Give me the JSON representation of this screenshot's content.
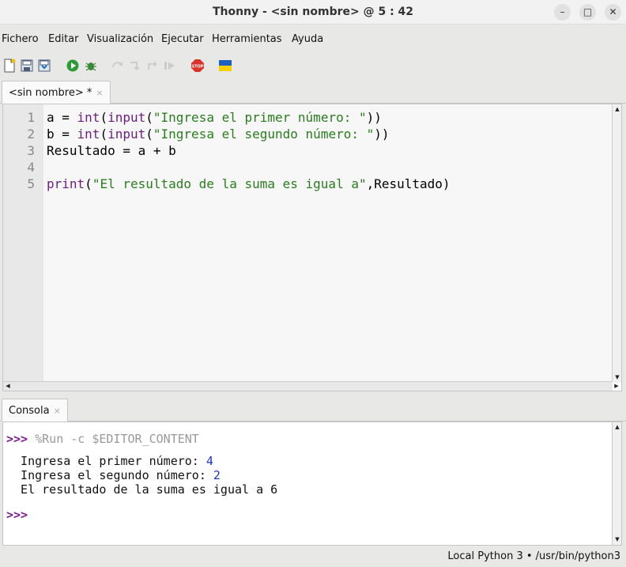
{
  "window": {
    "title": "Thonny  -  <sin nombre>  @  5 : 42"
  },
  "menu": [
    "Fichero",
    "Editar",
    "Visualización",
    "Ejecutar",
    "Herramientas",
    "Ayuda"
  ],
  "editor_tab": {
    "label": "<sin nombre> *",
    "close": "×"
  },
  "editor": {
    "line_numbers": [
      "1",
      "2",
      "3",
      "4",
      "5"
    ],
    "lines": [
      [
        {
          "t": "a = ",
          "c": ""
        },
        {
          "t": "int",
          "c": "kw"
        },
        {
          "t": "(",
          "c": ""
        },
        {
          "t": "input",
          "c": "kw"
        },
        {
          "t": "(",
          "c": ""
        },
        {
          "t": "\"Ingresa el primer número: \"",
          "c": "str"
        },
        {
          "t": "))",
          "c": ""
        }
      ],
      [
        {
          "t": "b = ",
          "c": ""
        },
        {
          "t": "int",
          "c": "kw"
        },
        {
          "t": "(",
          "c": ""
        },
        {
          "t": "input",
          "c": "kw"
        },
        {
          "t": "(",
          "c": ""
        },
        {
          "t": "\"Ingresa el segundo número: \"",
          "c": "str"
        },
        {
          "t": "))",
          "c": ""
        }
      ],
      [
        {
          "t": "Resultado = a + b",
          "c": ""
        }
      ],
      [
        {
          "t": "",
          "c": ""
        }
      ],
      [
        {
          "t": "print",
          "c": "kw"
        },
        {
          "t": "(",
          "c": ""
        },
        {
          "t": "\"El resultado de la suma es igual a\"",
          "c": "str"
        },
        {
          "t": ",Resultado)",
          "c": ""
        }
      ]
    ]
  },
  "console_tab": {
    "label": "Consola",
    "close": "×"
  },
  "console": {
    "prompt": ">>>",
    "command": " %Run -c $EDITOR_CONTENT",
    "out1_label": "  Ingresa el primer número: ",
    "out1_value": "4",
    "out2_label": "  Ingresa el segundo número: ",
    "out2_value": "2",
    "out3": "  El resultado de la suma es igual a 6",
    "prompt2": ">>>"
  },
  "status": {
    "interpreter": "Local Python 3  •  /usr/bin/python3"
  },
  "icons": [
    "new-file-icon",
    "open-file-icon",
    "save-file-icon",
    "run-icon",
    "debug-icon",
    "step-over-icon",
    "step-into-icon",
    "step-out-icon",
    "resume-icon",
    "stop-icon",
    "ukraine-flag-icon"
  ],
  "colors": {
    "keyword": "#6a1f7f",
    "string": "#2a7c1f",
    "prompt": "#7b1f89",
    "input_value": "#1b34c8"
  }
}
